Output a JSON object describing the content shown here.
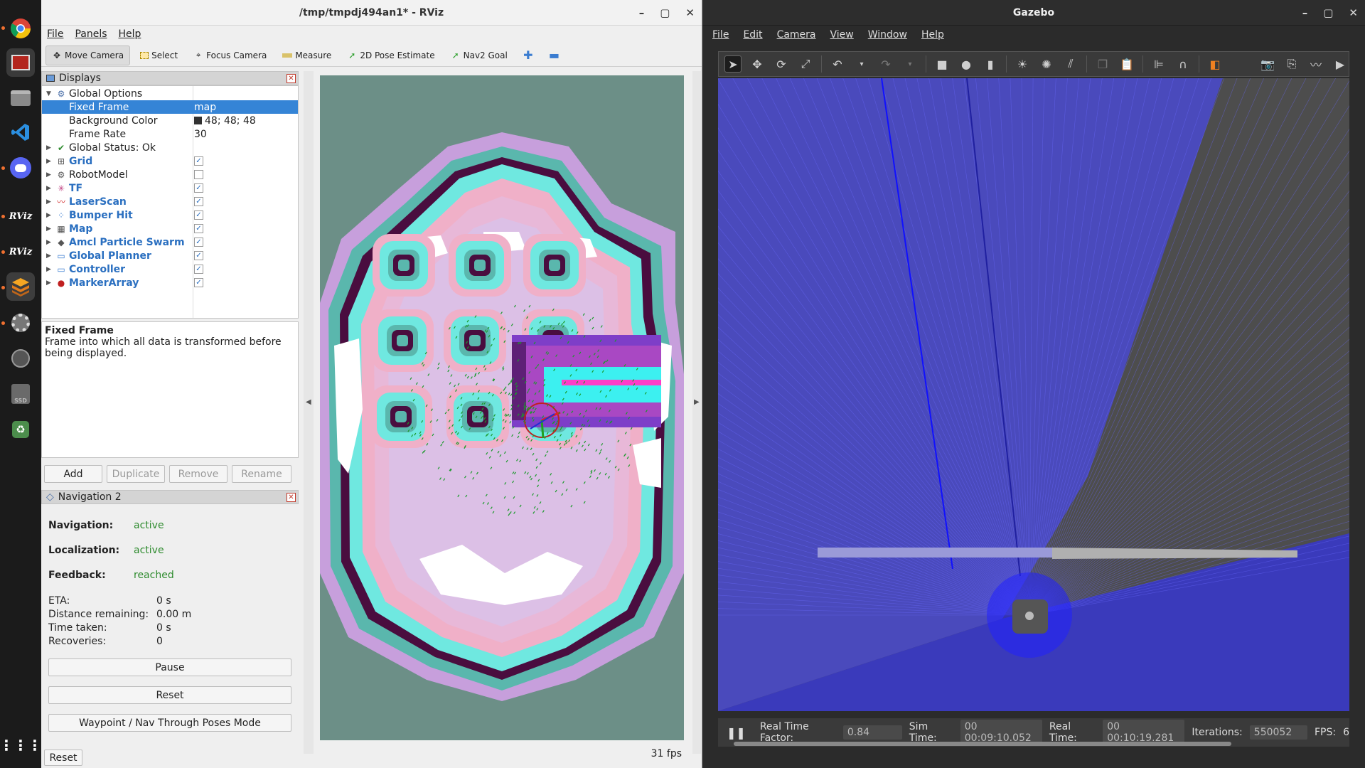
{
  "dock": {
    "items": [
      "chrome",
      "terminal",
      "files",
      "vscode",
      "discord",
      "rviz",
      "rviz",
      "gazebo",
      "settings",
      "disk",
      "ssd",
      "trash",
      "apps"
    ],
    "rviz_label": "RViz",
    "ssd_label": "SSD"
  },
  "rviz": {
    "title": "/tmp/tmpdj494an1* - RViz",
    "window_buttons": [
      "–",
      "▢",
      "✕"
    ],
    "menu": [
      "File",
      "Panels",
      "Help"
    ],
    "toolbar": [
      {
        "label": "Move Camera",
        "icon": "move-camera-icon",
        "active": true
      },
      {
        "label": "Select",
        "icon": "select-icon"
      },
      {
        "label": "Focus Camera",
        "icon": "focus-camera-icon"
      },
      {
        "label": "Measure",
        "icon": "measure-icon"
      },
      {
        "label": "2D Pose Estimate",
        "icon": "pose-estimate-icon"
      },
      {
        "label": "Nav2 Goal",
        "icon": "nav2-goal-icon"
      }
    ],
    "displays": {
      "title": "Displays",
      "global_options": "Global Options",
      "fixed_frame_label": "Fixed Frame",
      "fixed_frame_value": "map",
      "bg_color_label": "Background Color",
      "bg_color_value": "48; 48; 48",
      "frame_rate_label": "Frame Rate",
      "frame_rate_value": "30",
      "global_status": "Global Status: Ok",
      "items": [
        {
          "label": "Grid",
          "checked": true,
          "blue": true,
          "icon": "grid-icon"
        },
        {
          "label": "RobotModel",
          "checked": false,
          "blue": false,
          "icon": "robot-model-icon"
        },
        {
          "label": "TF",
          "checked": true,
          "blue": true,
          "icon": "tf-icon"
        },
        {
          "label": "LaserScan",
          "checked": true,
          "blue": true,
          "icon": "laserscan-icon"
        },
        {
          "label": "Bumper Hit",
          "checked": true,
          "blue": true,
          "icon": "bumper-hit-icon"
        },
        {
          "label": "Map",
          "checked": true,
          "blue": true,
          "icon": "map-icon"
        },
        {
          "label": "Amcl Particle Swarm",
          "checked": true,
          "blue": true,
          "icon": "particle-swarm-icon"
        },
        {
          "label": "Global Planner",
          "checked": true,
          "blue": true,
          "icon": "folder-icon"
        },
        {
          "label": "Controller",
          "checked": true,
          "blue": true,
          "icon": "folder-icon"
        },
        {
          "label": "MarkerArray",
          "checked": true,
          "blue": true,
          "icon": "marker-array-icon"
        }
      ]
    },
    "description": {
      "title": "Fixed Frame",
      "text": "Frame into which all data is transformed before being displayed."
    },
    "panel_buttons": {
      "add": "Add",
      "duplicate": "Duplicate",
      "remove": "Remove",
      "rename": "Rename"
    },
    "nav2": {
      "title": "Navigation 2",
      "navigation_label": "Navigation:",
      "navigation_value": "active",
      "localization_label": "Localization:",
      "localization_value": "active",
      "feedback_label": "Feedback:",
      "feedback_value": "reached",
      "eta_label": "ETA:",
      "eta_value": "0 s",
      "distance_label": "Distance remaining:",
      "distance_value": "0.00 m",
      "time_label": "Time taken:",
      "time_value": "0 s",
      "recoveries_label": "Recoveries:",
      "recoveries_value": "0",
      "pause": "Pause",
      "reset": "Reset",
      "waypoint_mode": "Waypoint / Nav Through Poses Mode"
    },
    "reset_bottom": "Reset",
    "fps": "31 fps"
  },
  "gazebo": {
    "title": "Gazebo",
    "window_buttons": [
      "–",
      "▢",
      "✕"
    ],
    "menu": [
      "File",
      "Edit",
      "Camera",
      "View",
      "Window",
      "Help"
    ],
    "status": {
      "rtf_label": "Real Time Factor:",
      "rtf_value": "0.84",
      "sim_time_label": "Sim Time:",
      "sim_time_value": "00 00:09:10.052",
      "real_time_label": "Real Time:",
      "real_time_value": "00 00:10:19.281",
      "iterations_label": "Iterations:",
      "iterations_value": "550052",
      "fps_label": "FPS:",
      "fps_value": "6"
    }
  }
}
